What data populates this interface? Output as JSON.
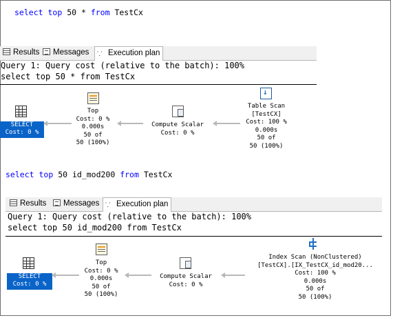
{
  "query1": {
    "sql": {
      "kw1": "select",
      "kw2": "top",
      "rest1": " 50 * ",
      "kw3": "from",
      "rest2": " TestCx"
    },
    "tabs": [
      {
        "label": "Results"
      },
      {
        "label": "Messages"
      },
      {
        "label": "Execution plan"
      }
    ],
    "header_line1": "Query 1: Query cost (relative to the batch): 100%",
    "header_line2": "select top 50 * from TestCx",
    "nodes": {
      "select": {
        "label": "SELECT",
        "cost": "Cost: 0 %"
      },
      "top": {
        "name": "Top",
        "cost": "Cost: 0 %",
        "time": "0.000s",
        "rows": "50 of",
        "pct": "50 (100%)"
      },
      "compute": {
        "name": "Compute Scalar",
        "cost": "Cost: 0 %"
      },
      "scan": {
        "name": "Table Scan",
        "object": "[TestCX]",
        "cost": "Cost: 100 %",
        "time": "0.000s",
        "rows": "50 of",
        "pct": "50 (100%)"
      }
    }
  },
  "query2": {
    "sql": {
      "kw1": "select",
      "kw2": "top",
      "rest1": " 50 id_mod200 ",
      "kw3": "from",
      "rest2": " TestCx"
    },
    "tabs": [
      {
        "label": "Results"
      },
      {
        "label": "Messages"
      },
      {
        "label": "Execution plan"
      }
    ],
    "header_line1": "Query 1: Query cost (relative to the batch): 100%",
    "header_line2": "select top 50 id_mod200 from TestCx",
    "nodes": {
      "select": {
        "label": "SELECT",
        "cost": "Cost: 0 %"
      },
      "top": {
        "name": "Top",
        "cost": "Cost: 0 %",
        "time": "0.000s",
        "rows": "50 of",
        "pct": "50 (100%)"
      },
      "compute": {
        "name": "Compute Scalar",
        "cost": "Cost: 0 %"
      },
      "scan": {
        "name": "Index Scan (NonClustered)",
        "object": "[TestCX].[IX_TestCX_id_mod20...",
        "cost": "Cost: 100 %",
        "time": "0.000s",
        "rows": "50 of",
        "pct": "50 (100%)"
      }
    }
  },
  "colors": {
    "keyword": "#0000ff",
    "selected_node": "#0a64c8",
    "arrow": "#b8b8b8"
  },
  "icons": [
    "grid-icon",
    "messages-icon",
    "execution-plan-icon",
    "select-icon",
    "top-icon",
    "compute-scalar-icon",
    "table-scan-icon",
    "index-scan-icon"
  ]
}
